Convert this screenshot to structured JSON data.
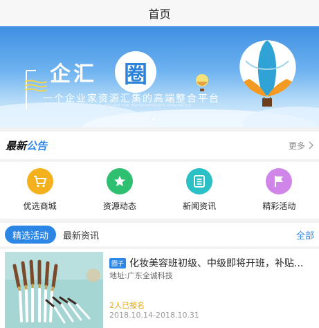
{
  "header": {
    "title": "首页"
  },
  "banner": {
    "logo_text": "企汇",
    "logo_circle_text": "圈",
    "slogan": "一个企业家资源汇集的高端整合平台",
    "slogan_en": "A HIGH-END INTEGRATION PLATFORM FOR ENTREPRENEURS RESOURCES"
  },
  "notice": {
    "title_a": "最新",
    "title_b": "公告",
    "more_label": "更多"
  },
  "categories": [
    {
      "label": "优选商城",
      "icon": "cart-icon",
      "color": "#f5b01e"
    },
    {
      "label": "资源动态",
      "icon": "star-icon",
      "color": "#2fbf71"
    },
    {
      "label": "新闻资讯",
      "icon": "news-icon",
      "color": "#2bbfc6"
    },
    {
      "label": "精彩活动",
      "icon": "flag-icon",
      "color": "#cf86e8"
    }
  ],
  "tabs": {
    "active": "精选活动",
    "other": "最新资讯",
    "all": "全部"
  },
  "activity": {
    "tag": "圈子",
    "title": "化妆美容班初级、中级即将开班，补贴...",
    "address": "地址:广东全诚科技",
    "signups": "2人已报名",
    "dates": "2018.10.14-2018.10.31"
  },
  "colors": {
    "accent": "#2b86e6",
    "signup": "#e5a713"
  }
}
